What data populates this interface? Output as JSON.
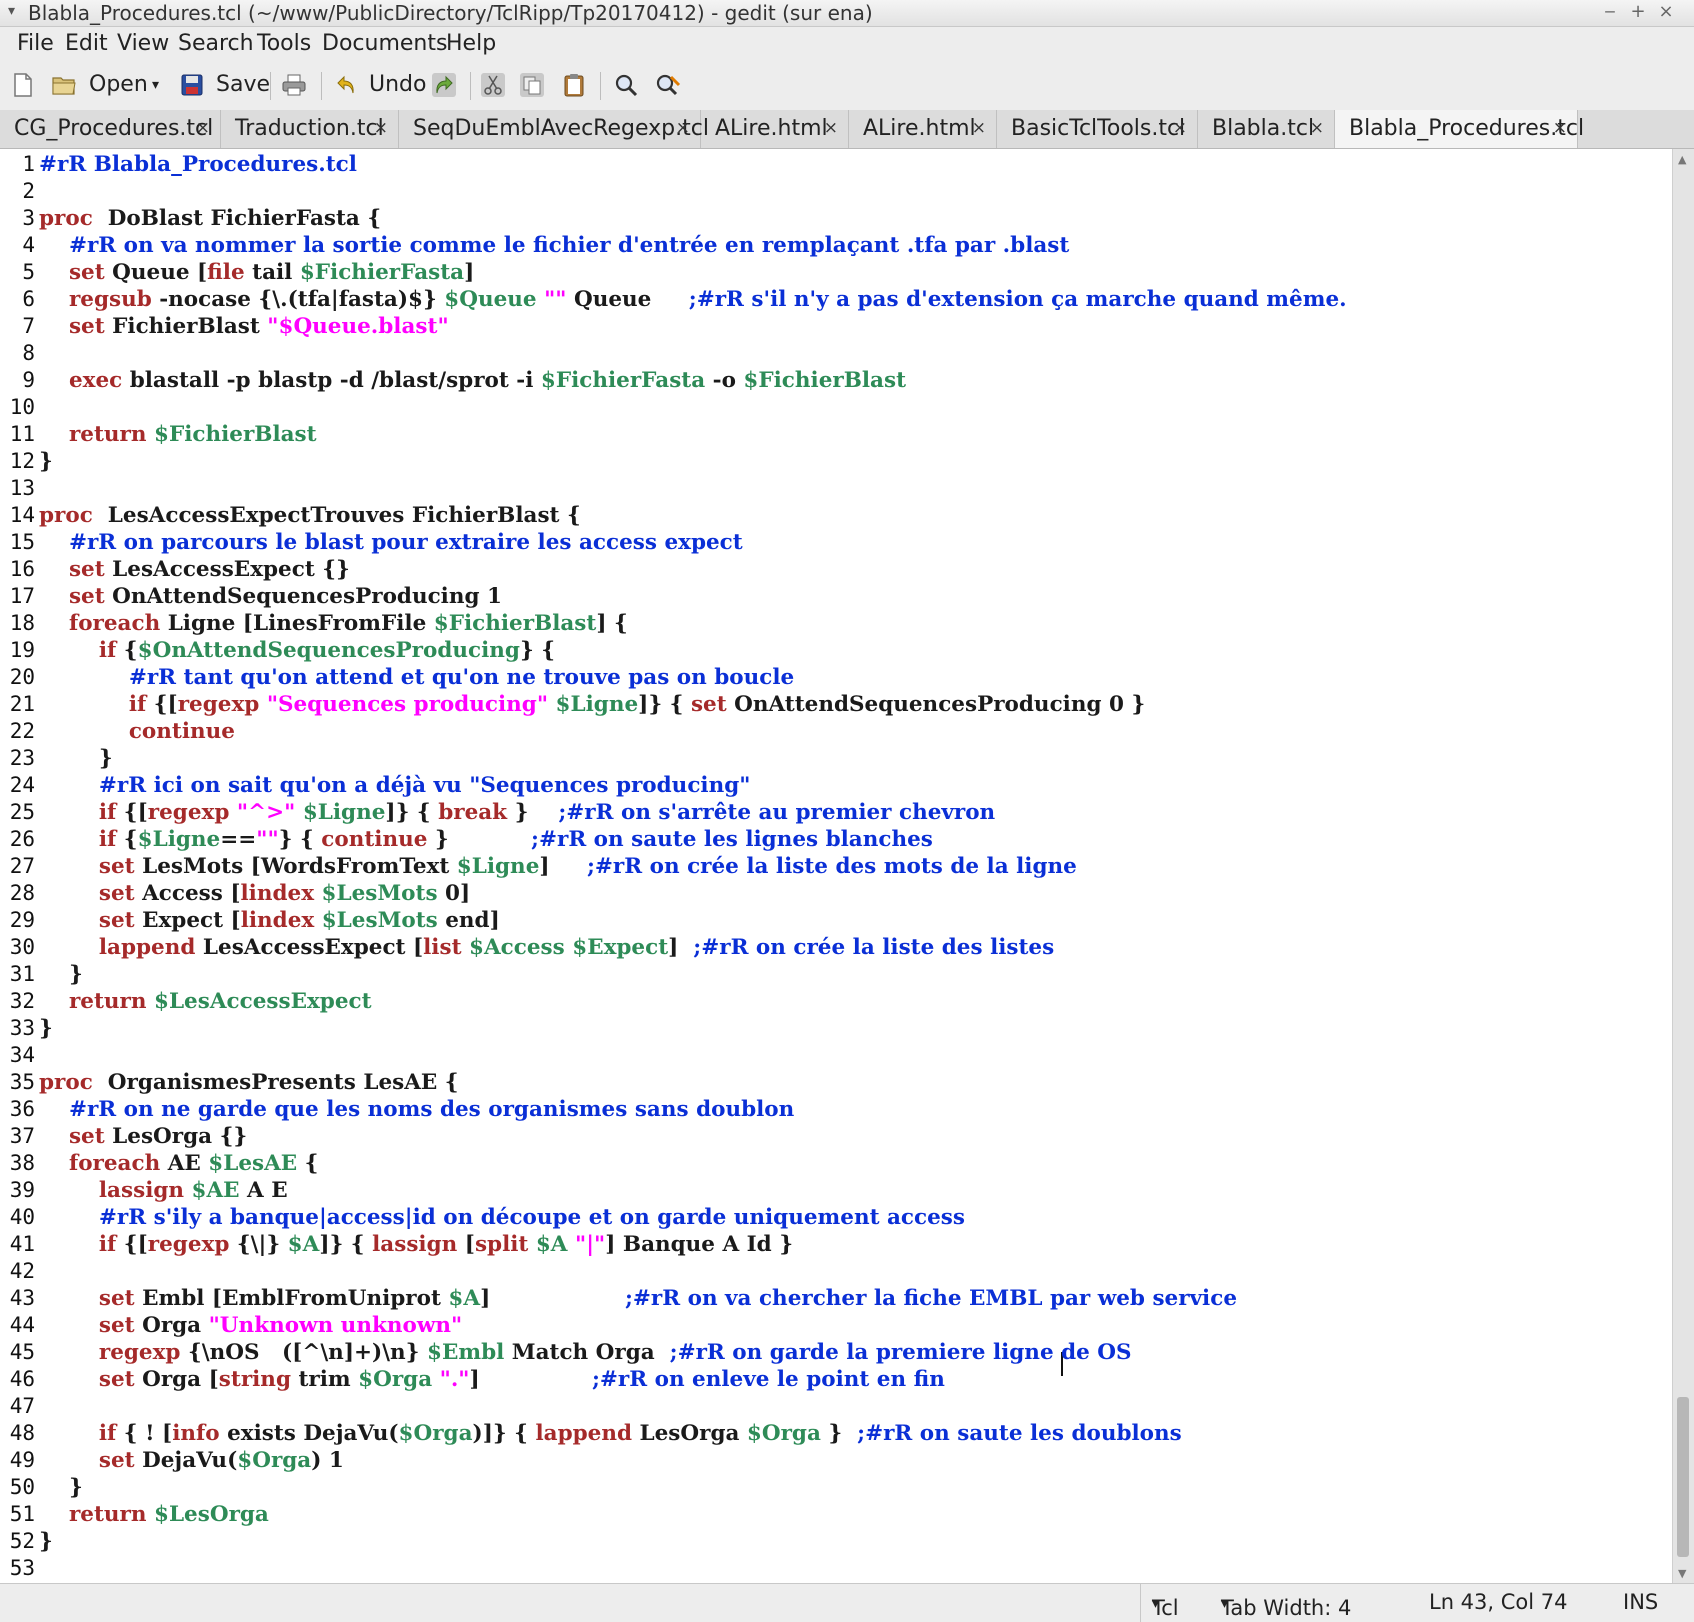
{
  "window": {
    "title": "Blabla_Procedures.tcl (~/www/PublicDirectory/TclRipp/Tp20170412) - gedit (sur ena)",
    "menu_arrow": "▾",
    "minimize": "‒",
    "maximize": "+",
    "close": "×"
  },
  "menu": [
    "File",
    "Edit",
    "View",
    "Search",
    "Tools",
    "Documents",
    "Help"
  ],
  "toolbar": {
    "open_label": "Open",
    "save_label": "Save",
    "undo_label": "Undo",
    "dropdown_arrow": "▾"
  },
  "tabs": [
    {
      "label": "CG_Procedures.tcl",
      "close": "×"
    },
    {
      "label": "Traduction.tcl",
      "close": "×"
    },
    {
      "label": "SeqDuEmblAvecRegexp.tcl",
      "close": "×"
    },
    {
      "label": "ALire.html",
      "close": "×"
    },
    {
      "label": "ALire.html",
      "close": "×"
    },
    {
      "label": "BasicTclTools.tcl",
      "close": "×"
    },
    {
      "label": "Blabla.tcl",
      "close": "×"
    },
    {
      "label": "Blabla_Procedures.tcl",
      "close": "×"
    }
  ],
  "active_tab": 7,
  "colors": {
    "keyword": "#a52a2a",
    "comment": "#0a2fd6",
    "variable": "#2e8b57",
    "string": "#ff00ff",
    "text": "#1a1a1a"
  },
  "code": [
    {
      "n": "1",
      "segs": [
        [
          "cm",
          "#rR Blabla_Procedures.tcl"
        ]
      ]
    },
    {
      "n": "2",
      "segs": []
    },
    {
      "n": "3",
      "segs": [
        [
          "kw",
          "proc"
        ],
        [
          "",
          "  DoBlast FichierFasta {"
        ]
      ]
    },
    {
      "n": "4",
      "segs": [
        [
          "",
          "    "
        ],
        [
          "cm",
          "#rR on va nommer la sortie comme le fichier d'entrée en remplaçant .tfa par .blast"
        ]
      ]
    },
    {
      "n": "5",
      "segs": [
        [
          "",
          "    "
        ],
        [
          "kw",
          "set"
        ],
        [
          "",
          " Queue ["
        ],
        [
          "kw",
          "file"
        ],
        [
          "",
          " tail "
        ],
        [
          "vr",
          "$FichierFasta"
        ],
        [
          "",
          "]"
        ]
      ]
    },
    {
      "n": "6",
      "segs": [
        [
          "",
          "    "
        ],
        [
          "kw",
          "regsub"
        ],
        [
          "",
          " -nocase {\\.(tfa|fasta)$} "
        ],
        [
          "vr",
          "$Queue"
        ],
        [
          "",
          " "
        ],
        [
          "st",
          "\"\""
        ],
        [
          "",
          " Queue     "
        ],
        [
          "cm",
          ";#rR s'il n'y a pas d'extension ça marche quand même."
        ]
      ]
    },
    {
      "n": "7",
      "segs": [
        [
          "",
          "    "
        ],
        [
          "kw",
          "set"
        ],
        [
          "",
          " FichierBlast "
        ],
        [
          "st",
          "\"$Queue.blast\""
        ]
      ]
    },
    {
      "n": "8",
      "segs": []
    },
    {
      "n": "9",
      "segs": [
        [
          "",
          "    "
        ],
        [
          "kw",
          "exec"
        ],
        [
          "",
          " blastall -p blastp -d /blast/sprot -i "
        ],
        [
          "vr",
          "$FichierFasta"
        ],
        [
          "",
          " -o "
        ],
        [
          "vr",
          "$FichierBlast"
        ]
      ]
    },
    {
      "n": "10",
      "segs": []
    },
    {
      "n": "11",
      "segs": [
        [
          "",
          "    "
        ],
        [
          "kw",
          "return"
        ],
        [
          "",
          " "
        ],
        [
          "vr",
          "$FichierBlast"
        ]
      ]
    },
    {
      "n": "12",
      "segs": [
        [
          "",
          "}"
        ]
      ]
    },
    {
      "n": "13",
      "segs": []
    },
    {
      "n": "14",
      "segs": [
        [
          "kw",
          "proc"
        ],
        [
          "",
          "  LesAccessExpectTrouves FichierBlast {"
        ]
      ]
    },
    {
      "n": "15",
      "segs": [
        [
          "",
          "    "
        ],
        [
          "cm",
          "#rR on parcours le blast pour extraire les access expect"
        ]
      ]
    },
    {
      "n": "16",
      "segs": [
        [
          "",
          "    "
        ],
        [
          "kw",
          "set"
        ],
        [
          "",
          " LesAccessExpect {}"
        ]
      ]
    },
    {
      "n": "17",
      "segs": [
        [
          "",
          "    "
        ],
        [
          "kw",
          "set"
        ],
        [
          "",
          " OnAttendSequencesProducing 1"
        ]
      ]
    },
    {
      "n": "18",
      "segs": [
        [
          "",
          "    "
        ],
        [
          "kw",
          "foreach"
        ],
        [
          "",
          " Ligne [LinesFromFile "
        ],
        [
          "vr",
          "$FichierBlast"
        ],
        [
          "",
          "] {"
        ]
      ]
    },
    {
      "n": "19",
      "segs": [
        [
          "",
          "        "
        ],
        [
          "kw",
          "if"
        ],
        [
          "",
          " {"
        ],
        [
          "vr",
          "$OnAttendSequencesProducing"
        ],
        [
          "",
          "} {"
        ]
      ]
    },
    {
      "n": "20",
      "segs": [
        [
          "",
          "            "
        ],
        [
          "cm",
          "#rR tant qu'on attend et qu'on ne trouve pas on boucle"
        ]
      ]
    },
    {
      "n": "21",
      "segs": [
        [
          "",
          "            "
        ],
        [
          "kw",
          "if"
        ],
        [
          "",
          " {["
        ],
        [
          "kw",
          "regexp"
        ],
        [
          "",
          " "
        ],
        [
          "st",
          "\"Sequences producing\""
        ],
        [
          "",
          " "
        ],
        [
          "vr",
          "$Ligne"
        ],
        [
          "",
          "]} { "
        ],
        [
          "kw",
          "set"
        ],
        [
          "",
          " OnAttendSequencesProducing 0 }"
        ]
      ]
    },
    {
      "n": "22",
      "segs": [
        [
          "",
          "            "
        ],
        [
          "kw",
          "continue"
        ]
      ]
    },
    {
      "n": "23",
      "segs": [
        [
          "",
          "        }"
        ]
      ]
    },
    {
      "n": "24",
      "segs": [
        [
          "",
          "        "
        ],
        [
          "cm",
          "#rR ici on sait qu'on a déjà vu \"Sequences producing\""
        ]
      ]
    },
    {
      "n": "25",
      "segs": [
        [
          "",
          "        "
        ],
        [
          "kw",
          "if"
        ],
        [
          "",
          " {["
        ],
        [
          "kw",
          "regexp"
        ],
        [
          "",
          " "
        ],
        [
          "st",
          "\"^>\""
        ],
        [
          "",
          " "
        ],
        [
          "vr",
          "$Ligne"
        ],
        [
          "",
          "]} { "
        ],
        [
          "kw",
          "break"
        ],
        [
          "",
          " }    "
        ],
        [
          "cm",
          ";#rR on s'arrête au premier chevron"
        ]
      ]
    },
    {
      "n": "26",
      "segs": [
        [
          "",
          "        "
        ],
        [
          "kw",
          "if"
        ],
        [
          "",
          " {"
        ],
        [
          "vr",
          "$Ligne"
        ],
        [
          "",
          "=="
        ],
        [
          "st",
          "\"\""
        ],
        [
          "",
          "} { "
        ],
        [
          "kw",
          "continue"
        ],
        [
          "",
          " }           "
        ],
        [
          "cm",
          ";#rR on saute les lignes blanches"
        ]
      ]
    },
    {
      "n": "27",
      "segs": [
        [
          "",
          "        "
        ],
        [
          "kw",
          "set"
        ],
        [
          "",
          " LesMots [WordsFromText "
        ],
        [
          "vr",
          "$Ligne"
        ],
        [
          "",
          "]     "
        ],
        [
          "cm",
          ";#rR on crée la liste des mots de la ligne"
        ]
      ]
    },
    {
      "n": "28",
      "segs": [
        [
          "",
          "        "
        ],
        [
          "kw",
          "set"
        ],
        [
          "",
          " Access ["
        ],
        [
          "kw",
          "lindex"
        ],
        [
          "",
          " "
        ],
        [
          "vr",
          "$LesMots"
        ],
        [
          "",
          " 0]"
        ]
      ]
    },
    {
      "n": "29",
      "segs": [
        [
          "",
          "        "
        ],
        [
          "kw",
          "set"
        ],
        [
          "",
          " Expect ["
        ],
        [
          "kw",
          "lindex"
        ],
        [
          "",
          " "
        ],
        [
          "vr",
          "$LesMots"
        ],
        [
          "",
          " end]"
        ]
      ]
    },
    {
      "n": "30",
      "segs": [
        [
          "",
          "        "
        ],
        [
          "kw",
          "lappend"
        ],
        [
          "",
          " LesAccessExpect ["
        ],
        [
          "kw",
          "list"
        ],
        [
          "",
          " "
        ],
        [
          "vr",
          "$Access"
        ],
        [
          "",
          " "
        ],
        [
          "vr",
          "$Expect"
        ],
        [
          "",
          "]  "
        ],
        [
          "cm",
          ";#rR on crée la liste des listes"
        ]
      ]
    },
    {
      "n": "31",
      "segs": [
        [
          "",
          "    }"
        ]
      ]
    },
    {
      "n": "32",
      "segs": [
        [
          "",
          "    "
        ],
        [
          "kw",
          "return"
        ],
        [
          "",
          " "
        ],
        [
          "vr",
          "$LesAccessExpect"
        ]
      ]
    },
    {
      "n": "33",
      "segs": [
        [
          "",
          "}"
        ]
      ]
    },
    {
      "n": "34",
      "segs": []
    },
    {
      "n": "35",
      "segs": [
        [
          "kw",
          "proc"
        ],
        [
          "",
          "  OrganismesPresents LesAE {"
        ]
      ]
    },
    {
      "n": "36",
      "segs": [
        [
          "",
          "    "
        ],
        [
          "cm",
          "#rR on ne garde que les noms des organismes sans doublon"
        ]
      ]
    },
    {
      "n": "37",
      "segs": [
        [
          "",
          "    "
        ],
        [
          "kw",
          "set"
        ],
        [
          "",
          " LesOrga {}"
        ]
      ]
    },
    {
      "n": "38",
      "segs": [
        [
          "",
          "    "
        ],
        [
          "kw",
          "foreach"
        ],
        [
          "",
          " AE "
        ],
        [
          "vr",
          "$LesAE"
        ],
        [
          "",
          " {"
        ]
      ]
    },
    {
      "n": "39",
      "segs": [
        [
          "",
          "        "
        ],
        [
          "kw",
          "lassign"
        ],
        [
          "",
          " "
        ],
        [
          "vr",
          "$AE"
        ],
        [
          "",
          " A E"
        ]
      ]
    },
    {
      "n": "40",
      "segs": [
        [
          "",
          "        "
        ],
        [
          "cm",
          "#rR s'ily a banque|access|id on découpe et on garde uniquement access"
        ]
      ]
    },
    {
      "n": "41",
      "segs": [
        [
          "",
          "        "
        ],
        [
          "kw",
          "if"
        ],
        [
          "",
          " {["
        ],
        [
          "kw",
          "regexp"
        ],
        [
          "",
          " {\\|} "
        ],
        [
          "vr",
          "$A"
        ],
        [
          "",
          "]} { "
        ],
        [
          "kw",
          "lassign"
        ],
        [
          "",
          " ["
        ],
        [
          "kw",
          "split"
        ],
        [
          "",
          " "
        ],
        [
          "vr",
          "$A"
        ],
        [
          "",
          " "
        ],
        [
          "st",
          "\"|\""
        ],
        [
          "",
          "] Banque A Id }"
        ]
      ]
    },
    {
      "n": "42",
      "segs": []
    },
    {
      "n": "43",
      "segs": [
        [
          "",
          "        "
        ],
        [
          "kw",
          "set"
        ],
        [
          "",
          " Embl [EmblFromUniprot "
        ],
        [
          "vr",
          "$A"
        ],
        [
          "",
          "]                  "
        ],
        [
          "cm",
          ";#rR on va chercher la fiche EMBL par web service"
        ]
      ]
    },
    {
      "n": "44",
      "segs": [
        [
          "",
          "        "
        ],
        [
          "kw",
          "set"
        ],
        [
          "",
          " Orga "
        ],
        [
          "st",
          "\"Unknown unknown\""
        ]
      ]
    },
    {
      "n": "45",
      "segs": [
        [
          "",
          "        "
        ],
        [
          "kw",
          "regexp"
        ],
        [
          "",
          " {\\nOS   ([^\\n]+)\\n} "
        ],
        [
          "vr",
          "$Embl"
        ],
        [
          "",
          " Match Orga  "
        ],
        [
          "cm",
          ";#rR on garde la premiere ligne de OS"
        ]
      ]
    },
    {
      "n": "46",
      "segs": [
        [
          "",
          "        "
        ],
        [
          "kw",
          "set"
        ],
        [
          "",
          " Orga ["
        ],
        [
          "kw",
          "string"
        ],
        [
          "",
          " trim "
        ],
        [
          "vr",
          "$Orga"
        ],
        [
          "",
          " "
        ],
        [
          "st",
          "\".\""
        ],
        [
          "",
          "]               "
        ],
        [
          "cm",
          ";#rR on enleve le point en fin"
        ]
      ]
    },
    {
      "n": "47",
      "segs": []
    },
    {
      "n": "48",
      "segs": [
        [
          "",
          "        "
        ],
        [
          "kw",
          "if"
        ],
        [
          "",
          " { ! ["
        ],
        [
          "kw",
          "info"
        ],
        [
          "",
          " exists DejaVu("
        ],
        [
          "vr",
          "$Orga"
        ],
        [
          "",
          ")]} { "
        ],
        [
          "kw",
          "lappend"
        ],
        [
          "",
          " LesOrga "
        ],
        [
          "vr",
          "$Orga"
        ],
        [
          "",
          " }  "
        ],
        [
          "cm",
          ";#rR on saute les doublons"
        ]
      ]
    },
    {
      "n": "49",
      "segs": [
        [
          "",
          "        "
        ],
        [
          "kw",
          "set"
        ],
        [
          "",
          " DejaVu("
        ],
        [
          "vr",
          "$Orga"
        ],
        [
          "",
          ") 1"
        ]
      ]
    },
    {
      "n": "50",
      "segs": [
        [
          "",
          "    }"
        ]
      ]
    },
    {
      "n": "51",
      "segs": [
        [
          "",
          "    "
        ],
        [
          "kw",
          "return"
        ],
        [
          "",
          " "
        ],
        [
          "vr",
          "$LesOrga"
        ]
      ]
    },
    {
      "n": "52",
      "segs": [
        [
          "",
          "}"
        ]
      ]
    },
    {
      "n": "53",
      "segs": []
    }
  ],
  "status": {
    "language": "Tcl",
    "tab_width": "Tab Width: 4",
    "position": "Ln 43, Col 74",
    "mode": "INS",
    "dropdown_arrow": "▾"
  }
}
